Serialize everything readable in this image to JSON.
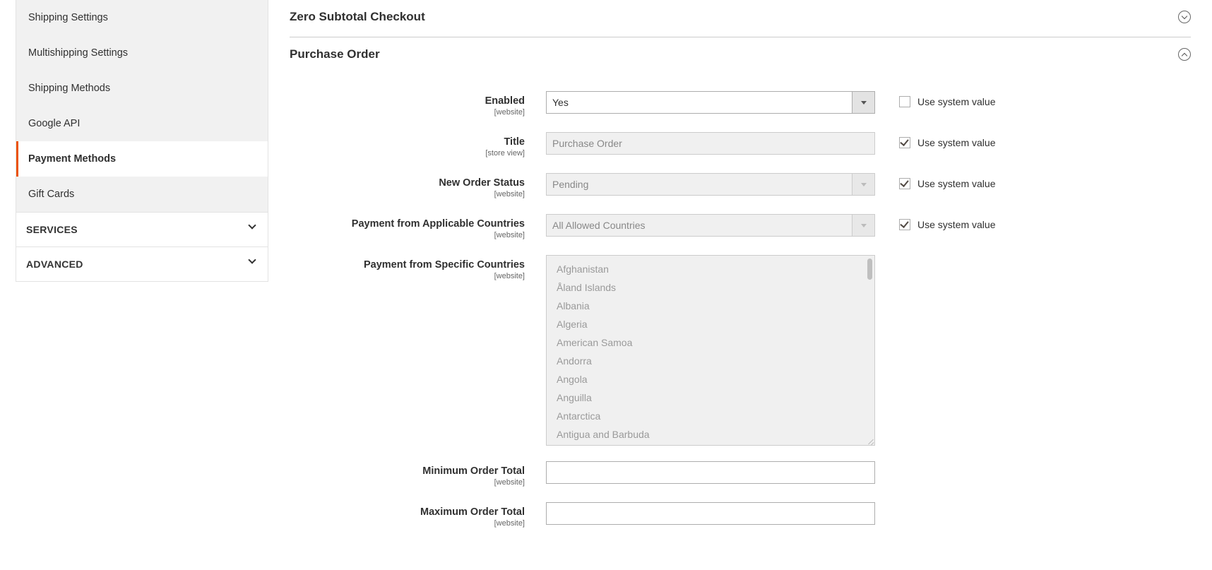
{
  "sidebar": {
    "items": [
      {
        "label": "Shipping Settings",
        "active": false
      },
      {
        "label": "Multishipping Settings",
        "active": false
      },
      {
        "label": "Shipping Methods",
        "active": false
      },
      {
        "label": "Google API",
        "active": false
      },
      {
        "label": "Payment Methods",
        "active": true
      },
      {
        "label": "Gift Cards",
        "active": false
      }
    ],
    "sections": [
      {
        "label": "SERVICES"
      },
      {
        "label": "ADVANCED"
      }
    ]
  },
  "main": {
    "zero_subtotal": {
      "title": "Zero Subtotal Checkout"
    },
    "purchase_order": {
      "title": "Purchase Order",
      "fields": {
        "enabled": {
          "label": "Enabled",
          "scope": "[website]",
          "value": "Yes",
          "use_system_label": "Use system value",
          "use_system_checked": false
        },
        "title": {
          "label": "Title",
          "scope": "[store view]",
          "value": "Purchase Order",
          "use_system_label": "Use system value",
          "use_system_checked": true
        },
        "new_order_status": {
          "label": "New Order Status",
          "scope": "[website]",
          "value": "Pending",
          "use_system_label": "Use system value",
          "use_system_checked": true
        },
        "applicable_countries": {
          "label": "Payment from Applicable Countries",
          "scope": "[website]",
          "value": "All Allowed Countries",
          "use_system_label": "Use system value",
          "use_system_checked": true
        },
        "specific_countries": {
          "label": "Payment from Specific Countries",
          "scope": "[website]",
          "options": [
            "Afghanistan",
            "Åland Islands",
            "Albania",
            "Algeria",
            "American Samoa",
            "Andorra",
            "Angola",
            "Anguilla",
            "Antarctica",
            "Antigua and Barbuda"
          ]
        },
        "min_order_total": {
          "label": "Minimum Order Total",
          "scope": "[website]",
          "value": ""
        },
        "max_order_total": {
          "label": "Maximum Order Total",
          "scope": "[website]",
          "value": ""
        }
      }
    }
  }
}
